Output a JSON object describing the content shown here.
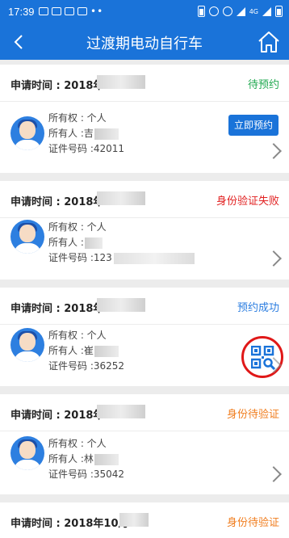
{
  "status_bar": {
    "time": "17:39",
    "network": "4G"
  },
  "navbar": {
    "title": "过渡期电动自行车",
    "back_icon": "back-arrow-icon",
    "home_icon": "home-icon"
  },
  "labels": {
    "apply_time": "申请时间 : 2018年",
    "ownership": "所有权 : 个人",
    "owner": "所有人 : ",
    "id_number": "证件号码 : "
  },
  "cards": [
    {
      "apply_time": "申请时间 : 2018年",
      "status": "待预约",
      "status_color": "#20a950",
      "owner_name": "吉",
      "id_number": "42011",
      "action": "立即预约"
    },
    {
      "apply_time": "申请时间 : 2018年",
      "status": "身份验证失败",
      "status_color": "#e12020",
      "owner_name": "",
      "id_number": "123"
    },
    {
      "apply_time": "申请时间 : 2018年",
      "status": "预约成功",
      "status_color": "#2b7de0",
      "owner_name": "崔",
      "id_number": "36252",
      "action_icon": "qr-code-search-icon"
    },
    {
      "apply_time": "申请时间 : 2018年",
      "status": "身份待验证",
      "status_color": "#f07d1e",
      "owner_name": "林",
      "id_number": "35042"
    },
    {
      "apply_time": "申请时间 : 2018年10月",
      "status": "身份待验证",
      "status_color": "#f07d1e"
    }
  ]
}
